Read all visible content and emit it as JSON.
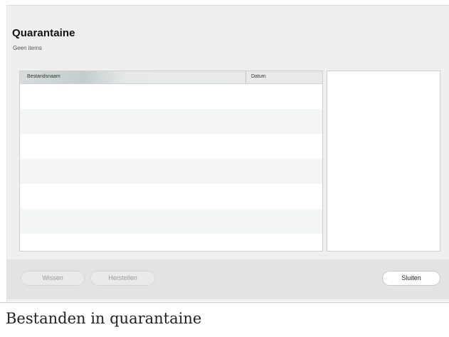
{
  "header": {
    "title": "Quarantaine",
    "subtitle": "Geen items"
  },
  "table": {
    "columns": [
      "Bestandsnaam",
      "Datum"
    ],
    "rows": []
  },
  "footer": {
    "clear_label": "Wissen",
    "restore_label": "Herstellen",
    "close_label": "Sluiten"
  },
  "caption": "Bestanden in quarantaine"
}
